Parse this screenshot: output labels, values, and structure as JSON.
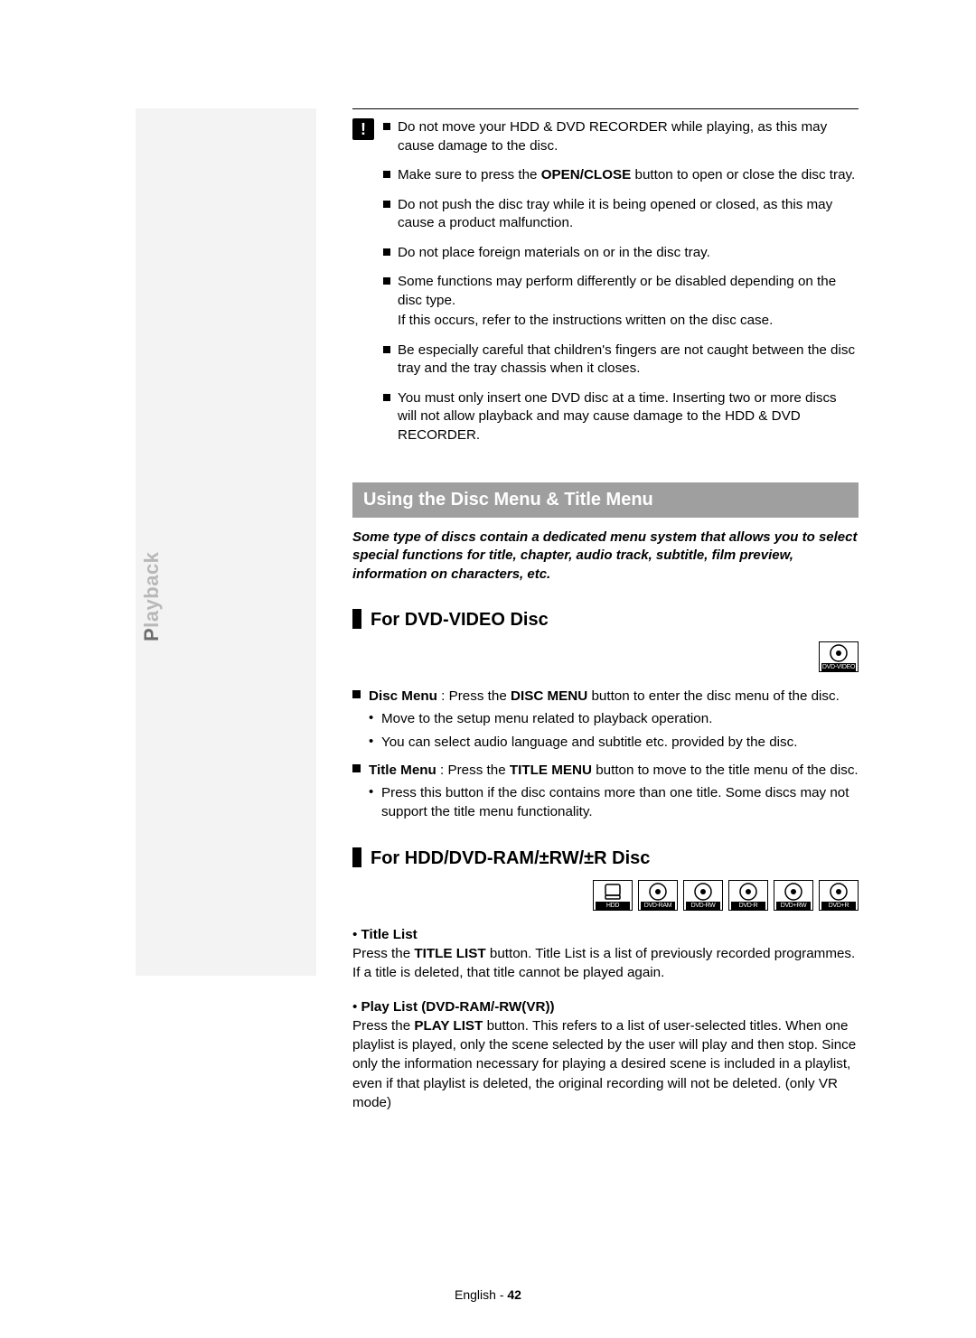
{
  "sidebar": {
    "label_hl": "P",
    "label_rest": "layback"
  },
  "warn_icon": "!",
  "cautions": [
    {
      "text": "Do not move your HDD & DVD RECORDER while playing, as this may cause damage to the disc."
    },
    {
      "pre": "Make sure to press the ",
      "bold": "OPEN/CLOSE",
      "post": " button to open or close the disc tray."
    },
    {
      "text": "Do not push the disc tray while it is being opened or closed, as this may cause a product malfunction."
    },
    {
      "text": "Do not place foreign materials on or in the disc tray."
    },
    {
      "text": "Some functions may perform differently or be disabled depending on the disc type.",
      "sub": "If this occurs, refer to the instructions written on the disc case."
    },
    {
      "text": "Be especially careful that children's fingers are not caught between the disc tray and the tray chassis when it closes."
    },
    {
      "text": "You must only insert one DVD disc at a time. Inserting two or more discs will not allow playback and may cause damage to the HDD & DVD RECORDER."
    }
  ],
  "section_title": "Using the Disc Menu & Title Menu",
  "intro": "Some type of discs contain a dedicated menu system that allows you to select special functions for title, chapter, audio track, subtitle, film preview, information on characters, etc.",
  "h1": "For DVD-VIDEO Disc",
  "dvdvideo_badge": "DVD-VIDEO",
  "disc_menu": {
    "label": "Disc Menu",
    "colon_pre": " : Press the ",
    "bold": "DISC MENU",
    "post": " button to enter the disc menu of the disc.",
    "bullets": [
      "Move to the setup menu related to playback operation.",
      "You can select audio language and subtitle etc. provided by the disc."
    ]
  },
  "title_menu": {
    "label": "Title Menu",
    "colon_pre": " : Press the ",
    "bold": "TITLE MENU",
    "post": " button to move to the title menu of the disc.",
    "bullets": [
      "Press this button if the disc contains more than one title. Some discs may not support the title menu functionality."
    ]
  },
  "h2": "For HDD/DVD-RAM/±RW/±R Disc",
  "badges2": [
    "HDD",
    "DVD-RAM",
    "DVD-RW",
    "DVD-R",
    "DVD+RW",
    "DVD+R"
  ],
  "title_list": {
    "head": "Title List",
    "pre": "Press the ",
    "bold": "TITLE LIST",
    "post": " button. Title List is a list of previously recorded programmes. If a title is deleted, that title cannot be played again."
  },
  "play_list": {
    "head": "Play List (DVD-RAM/-RW(VR))",
    "pre": "Press the ",
    "bold": "PLAY LIST",
    "post": " button. This refers to a list of user-selected titles. When one playlist is played, only the scene selected by the user will play and then stop. Since only the information necessary for playing a desired scene is included in a playlist, even if that playlist is deleted, the original recording will not be deleted. (only VR mode)"
  },
  "footer": {
    "lang": "English",
    "sep": " - ",
    "page": "42"
  }
}
